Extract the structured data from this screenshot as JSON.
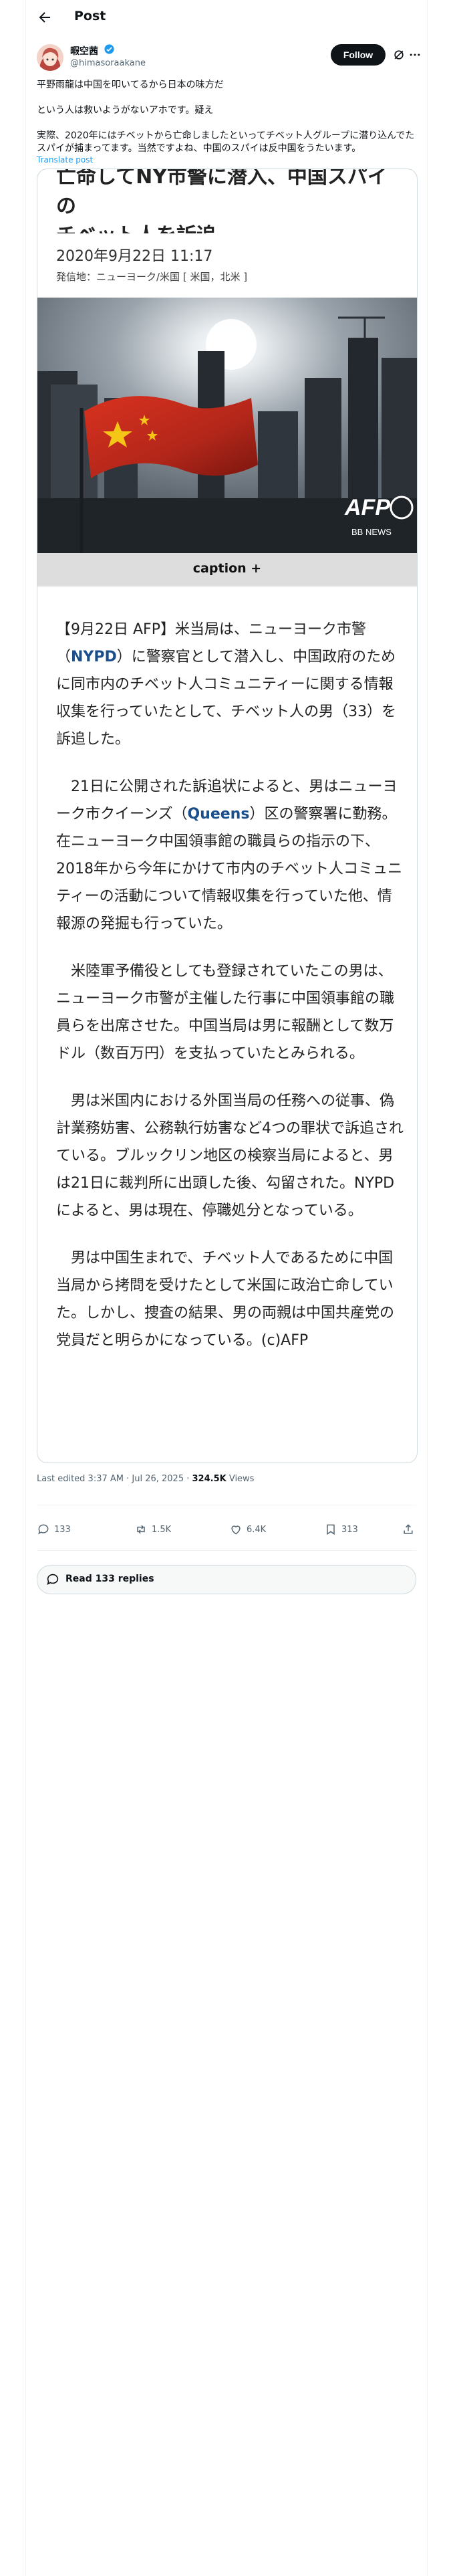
{
  "header": {
    "title": "Post"
  },
  "author": {
    "display_name": "暇空茜",
    "handle": "@himasoraakane",
    "follow_label": "Follow"
  },
  "post": {
    "lines": [
      "平野雨龍は中国を叩いてるから日本の味方だ",
      "という人は救いようがないアホです。疑え",
      "実際、2020年にはチベットから亡命しましたといってチベット人グループに潜り込んでたスパイが捕まってます。当然ですよね、中国のスパイは反中国をうたいます。"
    ],
    "translate": "Translate post"
  },
  "article": {
    "headline_line1": "亡命してNY市警に潜入、中国スパイの",
    "headline_line2": "チベット人を訴追",
    "date": "2020年9月22日 11:17",
    "dateline": "発信地：ニューヨーク/米国 [ 米国，北米 ]",
    "photo_credit": "AFP",
    "photo_credit2": "BB NEWS",
    "caption_label": "caption +",
    "p1_a": "【9月22日 AFP】米当局は、ニューヨーク市警（",
    "p1_link": "NYPD",
    "p1_b": "）に警察官として潜入し、中国政府のために同市内のチベット人コミュニティーに関する情報収集を行っていたとして、チベット人の男（33）を訴追した。",
    "p2_a": "21日に公開された訴追状によると、男はニューヨーク市クイーンズ（",
    "p2_link": "Queens",
    "p2_b": "）区の警察署に勤務。在ニューヨーク中国領事館の職員らの指示の下、2018年から今年にかけて市内のチベット人コミュニティーの活動について情報収集を行っていた他、情報源の発掘も行っていた。",
    "p3": "米陸軍予備役としても登録されていたこの男は、ニューヨーク市警が主催した行事に中国領事館の職員らを出席させた。中国当局は男に報酬として数万ドル（数百万円）を支払っていたとみられる。",
    "p4": "男は米国内における外国当局の任務への従事、偽計業務妨害、公務執行妨害など4つの罪状で訴追されている。ブルックリン地区の検察当局によると、男は21日に裁判所に出頭した後、勾留された。NYPDによると、男は現在、停職処分となっている。",
    "p5": "男は中国生まれで、チベット人であるために中国当局から拷問を受けたとして米国に政治亡命していた。しかし、捜査の結果、男の両親は中国共産党の党員だと明らかになっている。(c)AFP"
  },
  "meta": {
    "edited_prefix": "Last edited 3:37 AM · Jul 26, 2025 · ",
    "views_count": "324.5K",
    "views_label": " Views"
  },
  "actions": {
    "replies": "133",
    "reposts": "1.5K",
    "likes": "6.4K",
    "bookmarks": "313"
  },
  "read_replies": "Read 133 replies",
  "colors": {
    "accent": "#1d9bf0",
    "text": "#0f1419",
    "muted": "#536471"
  }
}
